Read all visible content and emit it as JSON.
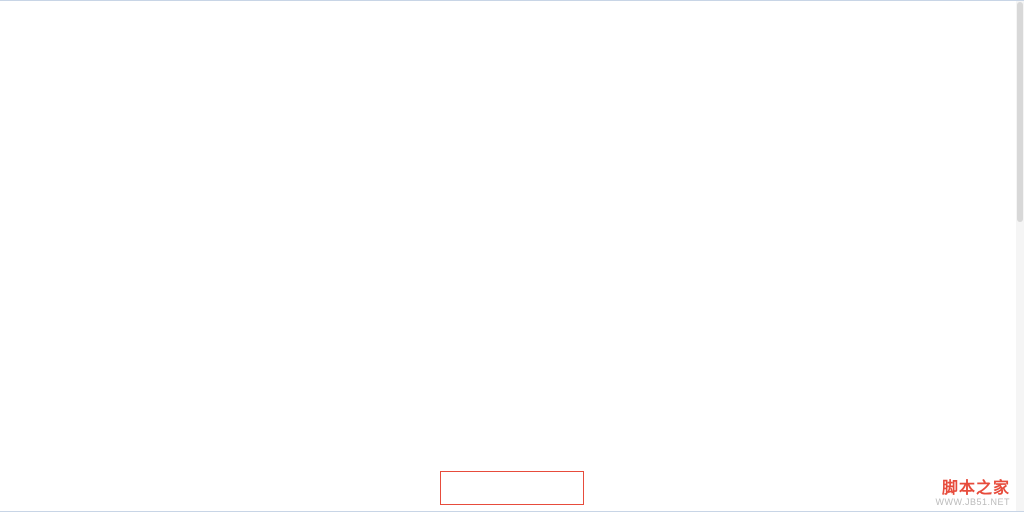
{
  "watermark": {
    "title": "脚本之家",
    "url": "WWW.JB51.NET"
  }
}
